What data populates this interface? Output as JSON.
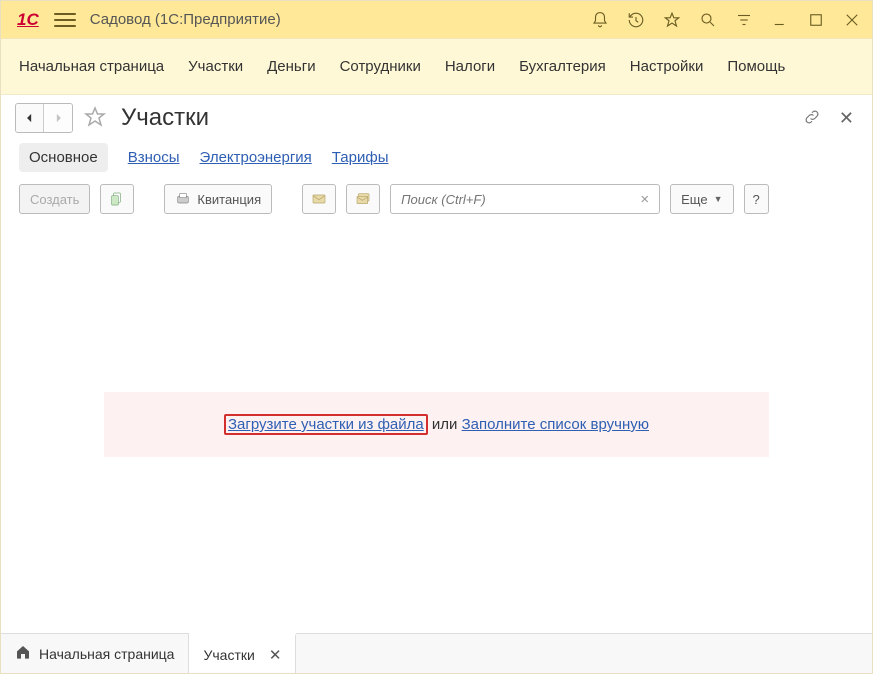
{
  "titlebar": {
    "app_name": "Садовод",
    "edition_suffix": "(1С:Предприятие)"
  },
  "menu": {
    "items": [
      "Начальная страница",
      "Участки",
      "Деньги",
      "Сотрудники",
      "Налоги",
      "Бухгалтерия",
      "Настройки",
      "Помощь"
    ]
  },
  "page": {
    "title": "Участки"
  },
  "subtabs": {
    "items": [
      "Основное",
      "Взносы",
      "Электроэнергия",
      "Тарифы"
    ],
    "active_index": 0
  },
  "toolbar": {
    "create_label": "Создать",
    "receipt_label": "Квитанция",
    "search_placeholder": "Поиск (Ctrl+F)",
    "more_label": "Еще",
    "help_label": "?"
  },
  "empty": {
    "link_load": "Загрузите участки из файла",
    "middle": " или ",
    "link_manual": "Заполните список вручную"
  },
  "bottom": {
    "home_label": "Начальная страница",
    "tab_label": "Участки"
  }
}
